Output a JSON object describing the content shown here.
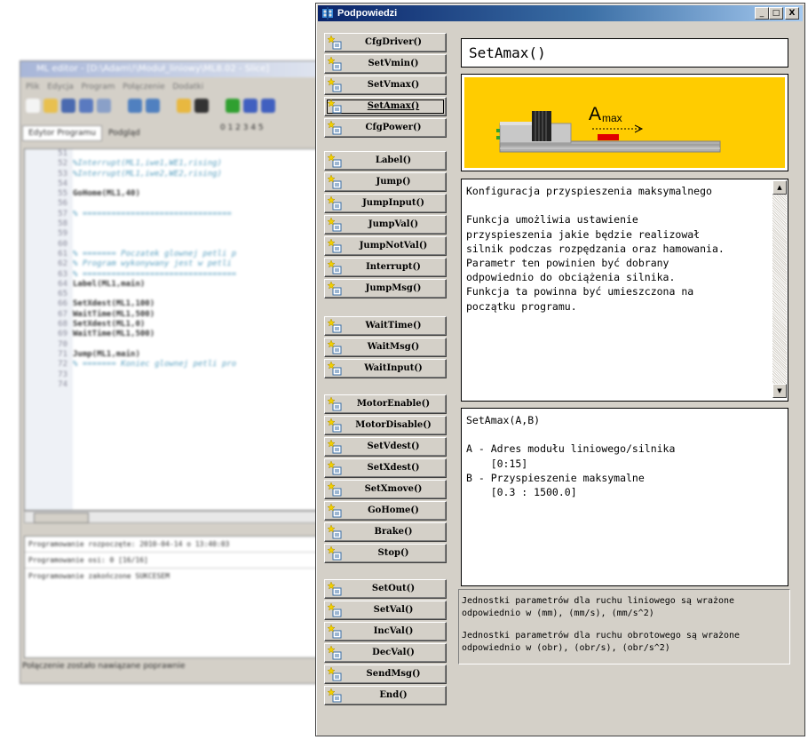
{
  "background_editor": {
    "title": "ML editor - [D:\\Adam\\!\\Moduł_liniowy\\ML8.02 - Slice]",
    "menu": [
      "Plik",
      "Edycja",
      "Program",
      "Połączenie",
      "Dodatki"
    ],
    "tabs": [
      "Edytor Programu",
      "Podgląd"
    ],
    "channels": "0 1 2 3   4 5",
    "code_lines": [
      {
        "num": "51",
        "text": "",
        "style": "plain"
      },
      {
        "num": "52",
        "text": "%Interrupt(ML1,iwe1,WE1,rising)",
        "style": "comment"
      },
      {
        "num": "53",
        "text": "%Interrupt(ML1,iwe2,WE2,rising)",
        "style": "comment"
      },
      {
        "num": "54",
        "text": "",
        "style": "plain"
      },
      {
        "num": "55",
        "text": "GoHome(ML1,40)",
        "style": "kw"
      },
      {
        "num": "56",
        "text": "",
        "style": "plain"
      },
      {
        "num": "57",
        "text": "% ===============================",
        "style": "comment"
      },
      {
        "num": "58",
        "text": "",
        "style": "plain"
      },
      {
        "num": "59",
        "text": "",
        "style": "plain"
      },
      {
        "num": "60",
        "text": "",
        "style": "plain"
      },
      {
        "num": "61",
        "text": "% ======= Poczatek glownej petli p",
        "style": "comment"
      },
      {
        "num": "62",
        "text": "% Program wykonywany jest w petli",
        "style": "comment"
      },
      {
        "num": "63",
        "text": "% ================================",
        "style": "comment"
      },
      {
        "num": "64",
        "text": "Label(ML1,main)",
        "style": "kw"
      },
      {
        "num": "65",
        "text": "",
        "style": "plain"
      },
      {
        "num": "66",
        "text": "SetXdest(ML1,100)",
        "style": "kw"
      },
      {
        "num": "67",
        "text": "WaitTime(ML1,500)",
        "style": "kw"
      },
      {
        "num": "68",
        "text": "SetXdest(ML1,0)",
        "style": "kw"
      },
      {
        "num": "69",
        "text": "WaitTime(ML1,500)",
        "style": "kw"
      },
      {
        "num": "70",
        "text": "",
        "style": "plain"
      },
      {
        "num": "71",
        "text": "Jump(ML1,main)",
        "style": "kw"
      },
      {
        "num": "72",
        "text": "% ======= Koniec glownej petli pro",
        "style": "comment"
      },
      {
        "num": "73",
        "text": "",
        "style": "plain"
      },
      {
        "num": "74",
        "text": "",
        "style": "plain"
      }
    ],
    "log": [
      "Programowanie rozpoczęte: 2010-04-14 o 13:40:03",
      "Programowanie osi:  0   [16/16]",
      "Programowanie zakończone SUKCESEM"
    ],
    "status": "Połączenie zostało nawiązane poprawnie"
  },
  "dialog": {
    "title": "Podpowiedzi",
    "minimize": "_",
    "maximize": "□",
    "close": "X",
    "button_groups": [
      [
        "CfgDriver()",
        "SetVmin()",
        "SetVmax()",
        "SetAmax()",
        "CfgPower()"
      ],
      [
        "Label()",
        "Jump()",
        "JumpInput()",
        "JumpVal()",
        "JumpNotVal()",
        "Interrupt()",
        "JumpMsg()"
      ],
      [
        "WaitTime()",
        "WaitMsg()",
        "WaitInput()"
      ],
      [
        "MotorEnable()",
        "MotorDisable()",
        "SetVdest()",
        "SetXdest()",
        "SetXmove()",
        "GoHome()",
        "Brake()",
        "Stop()"
      ],
      [
        "SetOut()",
        "SetVal()",
        "IncVal()",
        "DecVal()",
        "SendMsg()",
        "End()"
      ]
    ],
    "active_button": "SetAmax()",
    "function_name": "SetAmax()",
    "illustration": {
      "label": "A",
      "label_sub": "max",
      "background": "#ffcc00",
      "marker_color": "#e00000"
    },
    "description": "Konfiguracja przyspieszenia maksymalnego\n\nFunkcja umożliwia ustawienie\nprzyspieszenia jakie będzie realizował\nsilnik podczas rozpędzania oraz hamowania.\nParametr ten powinien być dobrany\nodpowiednio do obciążenia silnika.\nFunkcja ta powinna być umieszczona na\npoczątku programu.",
    "signature": "SetAmax(A,B)\n\nA - Adres modułu liniowego/silnika\n    [0:15]\nB - Przyspieszenie maksymalne\n    [0.3 : 1500.0]",
    "units_linear": "Jednostki parametrów dla ruchu liniowego są wrażone odpowiednio w (mm), (mm/s), (mm/s^2)",
    "units_rotary": "Jednostki parametrów dla ruchu obrotowego są wrażone odpowiednio w (obr), (obr/s), (obr/s^2)"
  }
}
